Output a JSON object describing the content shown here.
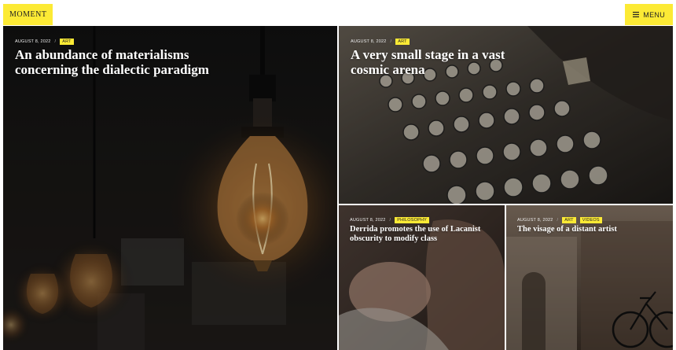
{
  "site": {
    "logo": "MOMENT",
    "menu_label": "MENU"
  },
  "posts": [
    {
      "date": "AUGUST 8, 2022",
      "category": "ART",
      "title": "An abundance of materialisms concerning the dialectic paradigm"
    },
    {
      "date": "AUGUST 8, 2022",
      "category": "ART",
      "title": "A very small stage in a vast cosmic arena"
    },
    {
      "date": "AUGUST 8, 2022",
      "category": "PHILOSOPHY",
      "title": "Derrida promotes the use of Lacanist obscurity to modify class"
    },
    {
      "date": "AUGUST 8, 2022",
      "category": "ART",
      "category2": "VIDEOS",
      "title": "The visage of a distant artist"
    }
  ],
  "colors": {
    "accent": "#fcea35"
  }
}
